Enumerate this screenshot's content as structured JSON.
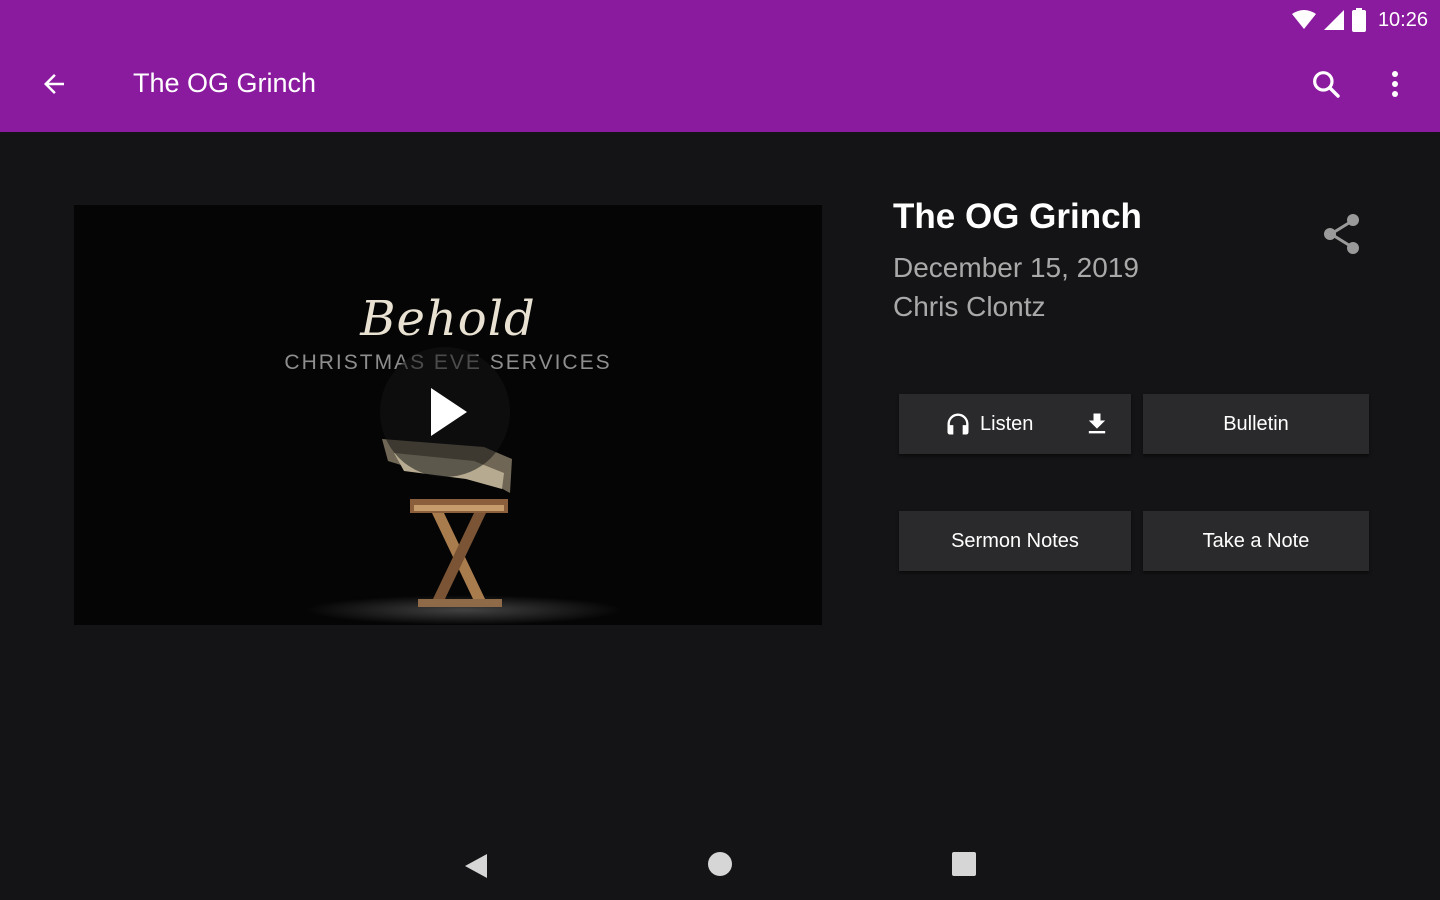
{
  "status_bar": {
    "time": "10:26",
    "icons": [
      "wifi-icon",
      "cell-signal-icon",
      "battery-icon"
    ]
  },
  "app_bar": {
    "title": "The OG Grinch",
    "back_icon": "arrow-back-icon",
    "search_icon": "search-icon",
    "more_icon": "more-vert-icon",
    "background_color": "#8a1a9e"
  },
  "video": {
    "title_art": "Behold",
    "subtitle_art": "CHRISTMAS EVE SERVICES",
    "play_icon": "play-icon"
  },
  "sermon": {
    "title": "The OG Grinch",
    "date": "December 15, 2019",
    "speaker": "Chris Clontz",
    "share_icon": "share-icon"
  },
  "actions": {
    "listen_label": "Listen",
    "listen_icon": "headphones-icon",
    "download_icon": "download-icon",
    "bulletin_label": "Bulletin",
    "sermon_notes_label": "Sermon Notes",
    "take_note_label": "Take a Note"
  },
  "nav_bar": {
    "icons": [
      "nav-back-icon",
      "nav-home-icon",
      "nav-recents-icon"
    ]
  }
}
